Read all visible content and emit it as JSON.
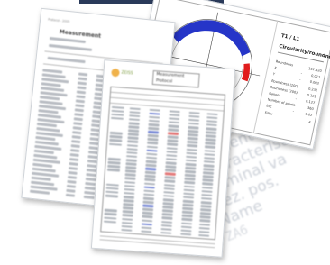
{
  "background_text": {
    "lines": [
      "element",
      "characteristi",
      "nominal va",
      "Bez. pos.",
      "Name"
    ],
    "codes": [
      "2005",
      "ZA6"
    ]
  },
  "sheet_right": {
    "title": "T1 / L1",
    "subtitle": "Circularity/roundness",
    "parameters": [
      {
        "key": "Roundness",
        "sep": "",
        "value": "167,820"
      },
      {
        "key": "X",
        "sep": "-",
        "value": "0.011"
      },
      {
        "key": "Y",
        "sep": "-",
        "value": "0.003"
      },
      {
        "key": "Roundness (100)",
        "sep": "-",
        "value": "0.232"
      },
      {
        "key": "Roundness (200)",
        "sep": "-",
        "value": "0.121"
      },
      {
        "key": "Range",
        "sep": "-",
        "value": "0.127"
      },
      {
        "key": "Number of points",
        "sep": "",
        "value": "360"
      },
      {
        "key": "Ecc",
        "sep": "-",
        "value": "0.02"
      },
      {
        "key": "Filter",
        "sep": "",
        "value": "4"
      }
    ],
    "plot_colors": {
      "positive": "#2535c8",
      "negative": "#e11d1d"
    }
  },
  "sheet_front": {
    "logo": "ZEISS",
    "header_1": "Measurement",
    "header_2": "Protocol"
  },
  "sheet_left": {
    "header": "Protocol - 2005",
    "title": "Measurement"
  }
}
